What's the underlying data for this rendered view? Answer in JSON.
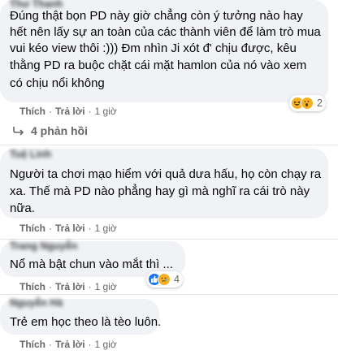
{
  "comments": [
    {
      "author": "Thư Thanh",
      "lines": [
        "Đúng thật bọn PD này giờ chẳng còn ý tưởng nào hay",
        "hết nên lấy sự an toàn của các thành viên để làm trò mua",
        "vui kéo view thôi :))) Đm nhìn Ji xót đ' chịu được, kêu",
        "thằng PD ra buộc chặt cái mặt hamlon của nó vào xem",
        "có chịu nổi không"
      ],
      "like_label": "Thích",
      "reply_label": "Trả lời",
      "time": "1 giờ",
      "reaction_count": "2"
    },
    {
      "author": "Tuệ Linh",
      "lines": [
        "Người ta chơi mạo hiểm với quả dưa hấu, họ còn chạy ra",
        "xa. Thế mà PD nào phẳng hay gì mà nghĩ ra cái trò này",
        "nữa."
      ],
      "like_label": "Thích",
      "reply_label": "Trả lời",
      "time": "1 giờ"
    },
    {
      "author": "Trang Nguyễn",
      "lines": [
        "Nổ mà bật chun vào mắt thì ..."
      ],
      "like_label": "Thích",
      "reply_label": "Trả lời",
      "time": "1 giờ",
      "reaction_count": "4"
    },
    {
      "author": "Nguyễn Hà",
      "lines": [
        "Trẻ em học theo là tèo luôn."
      ],
      "like_label": "Thích",
      "reply_label": "Trả lời",
      "time": "1 giờ"
    }
  ],
  "replies_link": "4 phản hồi",
  "colors": {
    "bubble": "#f0f2f5",
    "secondary_text": "#65676b",
    "like_blue": "#1877f2",
    "emoji_yellow": "#f7b125"
  },
  "icons": [
    "reply-arrow-icon",
    "like-reaction-icon",
    "haha-reaction-icon",
    "sad-reaction-icon"
  ]
}
